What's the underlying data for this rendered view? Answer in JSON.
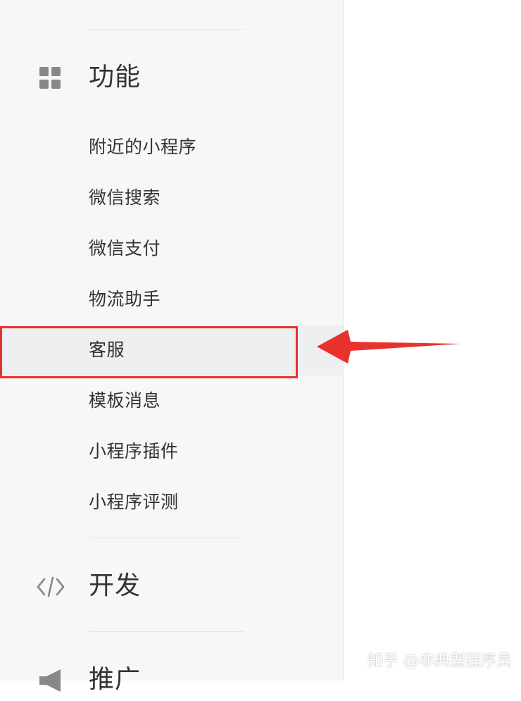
{
  "sidebar": {
    "sections": [
      {
        "title": "功能",
        "icon": "grid-icon",
        "items": [
          {
            "label": "附近的小程序"
          },
          {
            "label": "微信搜索"
          },
          {
            "label": "微信支付"
          },
          {
            "label": "物流助手"
          },
          {
            "label": "客服",
            "active": true
          },
          {
            "label": "模板消息"
          },
          {
            "label": "小程序插件"
          },
          {
            "label": "小程序评测"
          }
        ]
      },
      {
        "title": "开发",
        "icon": "code-icon"
      },
      {
        "title": "推广",
        "icon": "megaphone-icon"
      }
    ]
  },
  "watermark": "知乎 @非典型程序员",
  "colors": {
    "sidebar_bg": "#f6f7f9",
    "active_bg": "#eeeff1",
    "annotation": "#e9312d",
    "text": "#333333"
  }
}
